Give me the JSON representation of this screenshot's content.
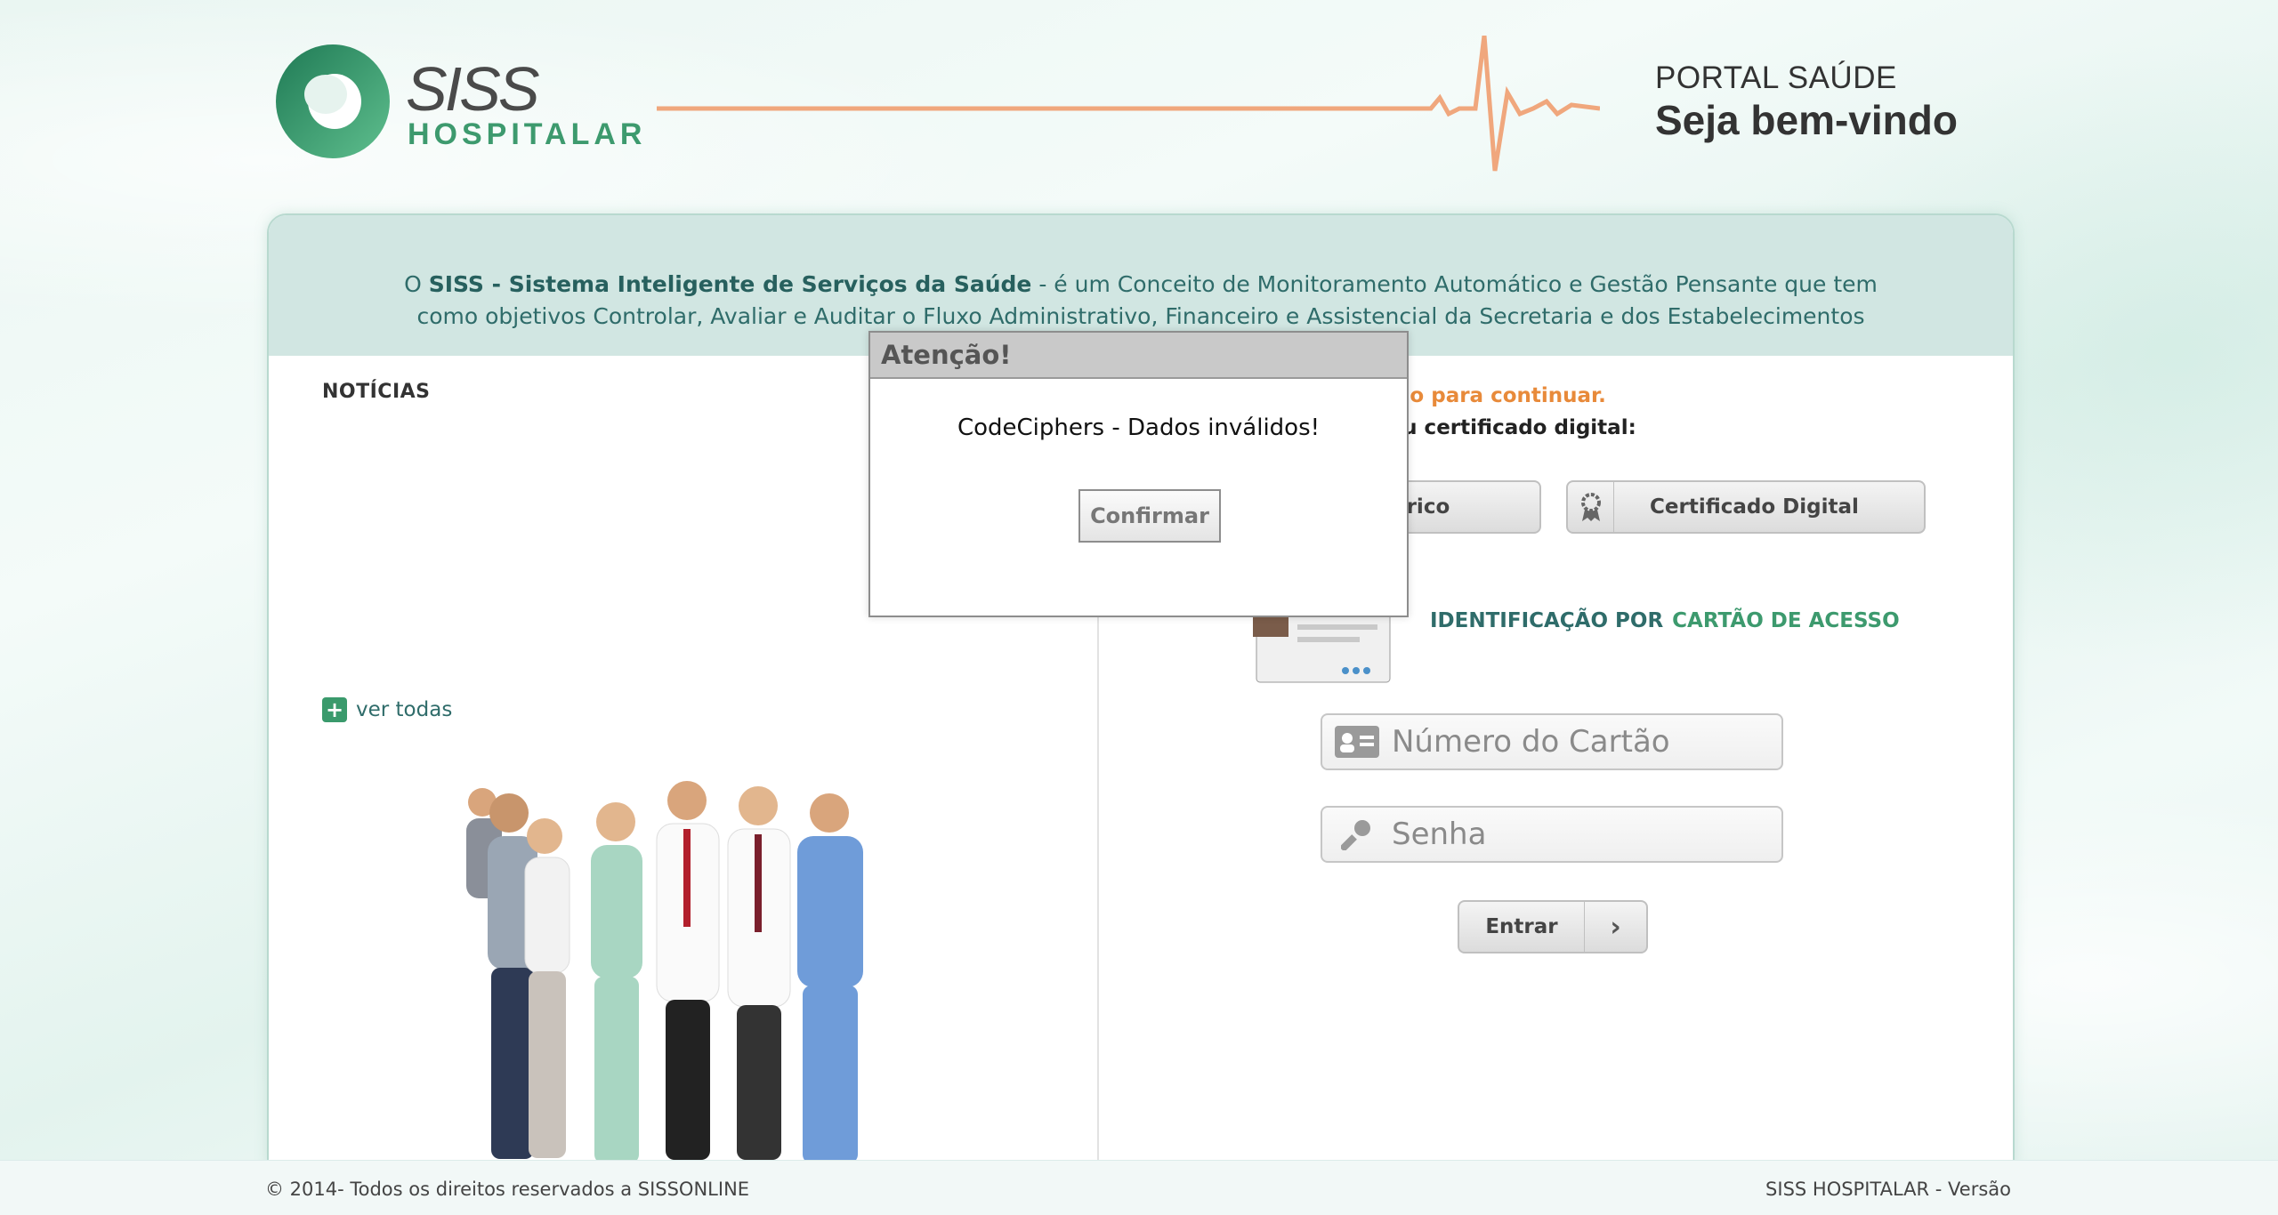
{
  "header": {
    "logo": {
      "main": "SISS",
      "sub": "HOSPITALAR"
    },
    "portal_title": "PORTAL SAÚDE",
    "portal_subtitle": "Seja bem-vindo",
    "pulse_color": "#f0a77d"
  },
  "intro": {
    "prefix": "O ",
    "bold": "SISS - Sistema Inteligente de Serviços da Saúde",
    "rest": " - é um Conceito de Monitoramento Automático e Gestão Pensante que tem como objetivos Controlar, Avaliar e Auditar o Fluxo Administrativo, Financeiro e Assistencial da Secretaria e dos Estabelecimentos da Saúde."
  },
  "news": {
    "title": "NOTÍCIAS",
    "see_all": "ver todas"
  },
  "login": {
    "warning": "ária sua identificação para continuar.",
    "access_hint": "acesso por cartão ou certificado digital:",
    "biometric_button": "étrico",
    "certificate_button": "Certificado Digital",
    "ident_label": "IDENTIFICAÇÃO POR",
    "ident_accent": "CARTÃO DE ACESSO",
    "card_placeholder": "Número do Cartão",
    "password_placeholder": "Senha",
    "enter_button": "Entrar"
  },
  "footer": {
    "copyright": "© 2014- Todos os direitos reservados a SISSONLINE",
    "version": "SISS HOSPITALAR - Versão"
  },
  "dialog": {
    "title": "Atenção!",
    "message": "CodeCiphers - Dados inválidos!",
    "confirm": "Confirmar"
  },
  "colors": {
    "brand_green": "#3d9a6e",
    "teal_text": "#2f6c6a",
    "warning_orange": "#e88a3a",
    "intro_bg": "#d1e6e2"
  }
}
